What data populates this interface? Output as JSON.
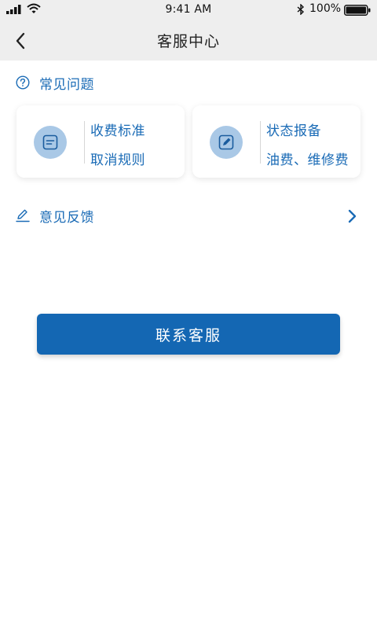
{
  "status_bar": {
    "time": "9:41 AM",
    "battery": "100%"
  },
  "header": {
    "title": "客服中心"
  },
  "faq": {
    "heading": "常见问题",
    "cards": [
      {
        "line1": "收费标准",
        "line2": "取消规则"
      },
      {
        "line1": "状态报备",
        "line2": "油费、维修费"
      }
    ]
  },
  "feedback": {
    "label": "意见反馈"
  },
  "contact": {
    "label": "联系客服"
  },
  "colors": {
    "accent": "#1467b3",
    "text_accent": "#1a6bb6",
    "icon_bg": "#a9c8e6",
    "header_bg": "#eeeeee"
  }
}
